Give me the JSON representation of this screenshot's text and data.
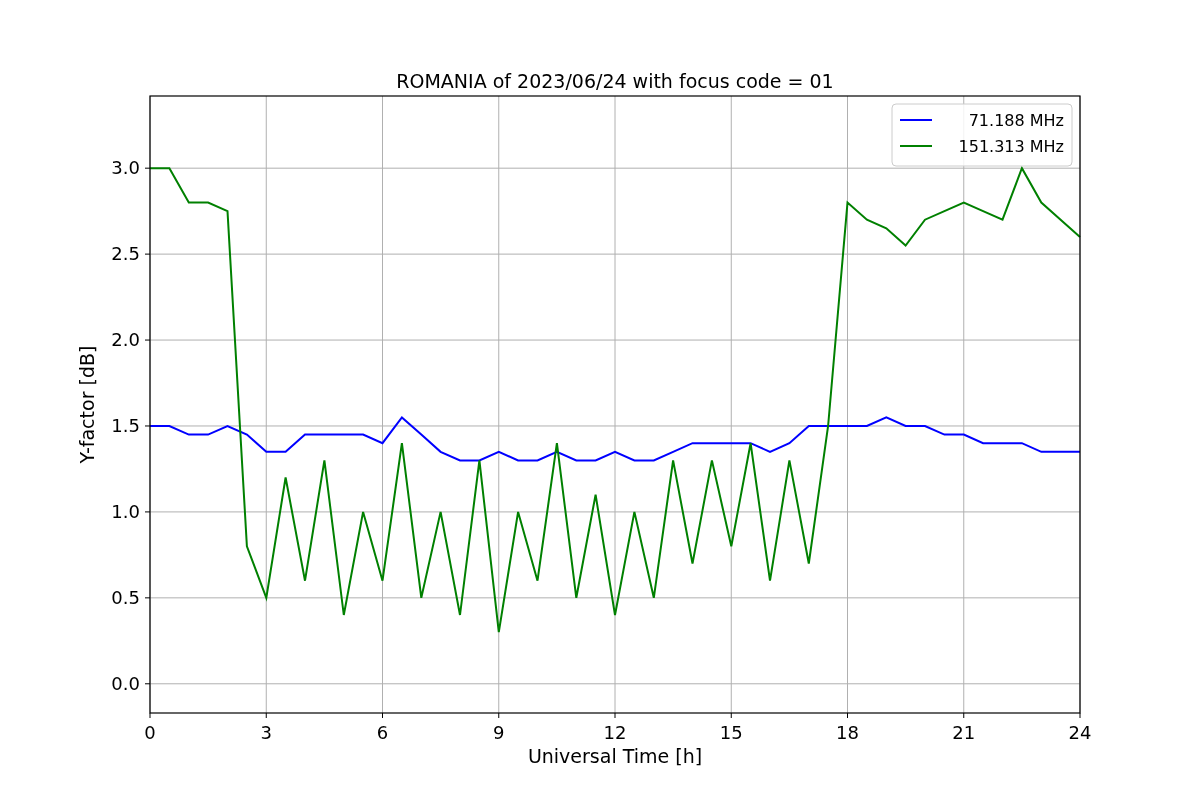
{
  "chart_data": {
    "type": "line",
    "title": "ROMANIA of 2023/06/24 with focus code = 01",
    "xlabel": "Universal Time [h]",
    "ylabel": "Y-factor [dB]",
    "x": [
      0,
      0.5,
      1,
      1.5,
      2,
      2.5,
      3,
      3.5,
      4,
      4.5,
      5,
      5.5,
      6,
      6.5,
      7,
      7.5,
      8,
      8.5,
      9,
      9.5,
      10,
      10.5,
      11,
      11.5,
      12,
      12.5,
      13,
      13.5,
      14,
      14.5,
      15,
      15.5,
      16,
      16.5,
      17,
      17.5,
      18,
      18.5,
      19,
      19.5,
      20,
      20.5,
      21,
      21.5,
      22,
      22.5,
      23,
      23.5,
      24
    ],
    "series": [
      {
        "name": "71.188 MHz",
        "color": "#0000ff",
        "values": [
          1.5,
          1.5,
          1.45,
          1.45,
          1.5,
          1.45,
          1.35,
          1.35,
          1.45,
          1.45,
          1.45,
          1.45,
          1.4,
          1.55,
          1.45,
          1.35,
          1.3,
          1.3,
          1.35,
          1.3,
          1.3,
          1.35,
          1.3,
          1.3,
          1.35,
          1.3,
          1.3,
          1.35,
          1.4,
          1.4,
          1.4,
          1.4,
          1.35,
          1.4,
          1.5,
          1.5,
          1.5,
          1.5,
          1.55,
          1.5,
          1.5,
          1.45,
          1.45,
          1.4,
          1.4,
          1.4,
          1.35,
          1.35,
          1.35
        ]
      },
      {
        "name": "151.313 MHz",
        "color": "#008000",
        "values": [
          3.0,
          3.0,
          2.8,
          2.8,
          2.75,
          0.8,
          0.5,
          1.2,
          0.6,
          1.3,
          0.4,
          1.0,
          0.6,
          1.4,
          0.5,
          1.0,
          0.4,
          1.3,
          0.3,
          1.0,
          0.6,
          1.4,
          0.5,
          1.1,
          0.4,
          1.0,
          0.5,
          1.3,
          0.7,
          1.3,
          0.8,
          1.4,
          0.6,
          1.3,
          0.7,
          1.5,
          2.8,
          2.7,
          2.65,
          2.55,
          2.7,
          2.75,
          2.8,
          2.75,
          2.7,
          3.0,
          2.8,
          2.7,
          2.6
        ]
      }
    ],
    "grid": true,
    "legend": true,
    "xlim": [
      0,
      24
    ],
    "ylim": [
      -0.17,
      3.42
    ],
    "xticks": [
      0,
      3,
      6,
      9,
      12,
      15,
      18,
      21,
      24
    ],
    "yticks": [
      {
        "value": 0,
        "label": "0.0"
      },
      {
        "value": 0.5,
        "label": "0.5"
      },
      {
        "value": 1,
        "label": "1.0"
      },
      {
        "value": 1.5,
        "label": "1.5"
      },
      {
        "value": 2,
        "label": "2.0"
      },
      {
        "value": 2.5,
        "label": "2.5"
      },
      {
        "value": 3,
        "label": "3.0"
      }
    ]
  }
}
